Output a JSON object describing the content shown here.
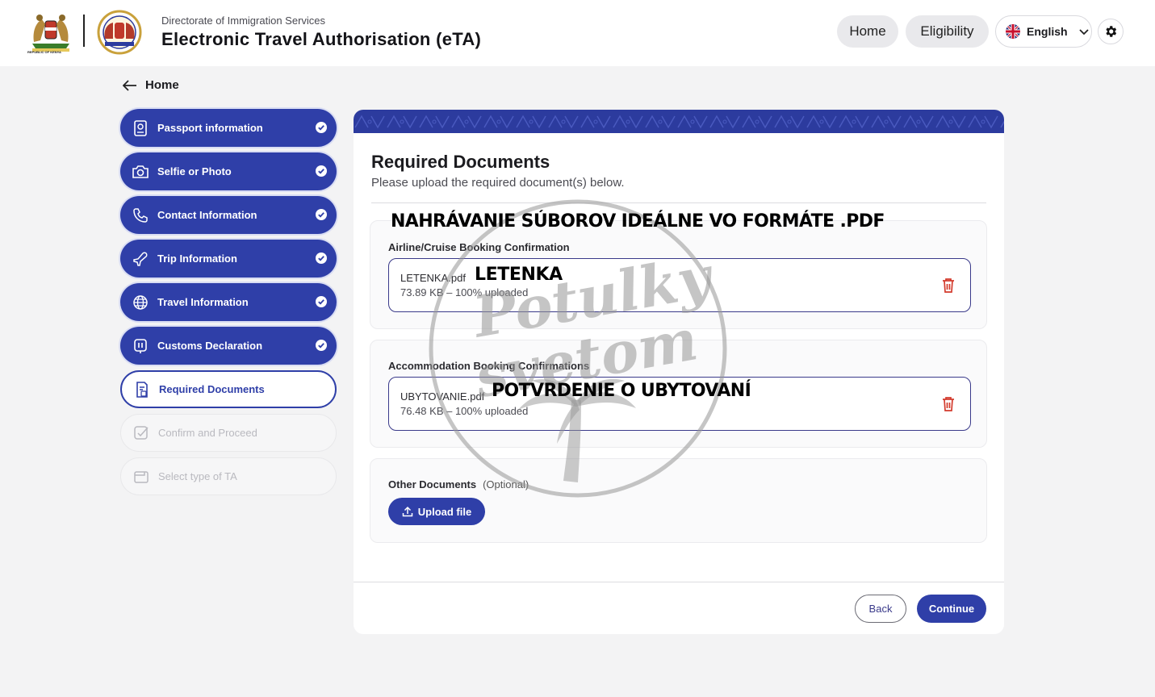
{
  "header": {
    "subtitle": "Directorate of Immigration Services",
    "title": "Electronic Travel Authorisation (eTA)",
    "kenya_logo_caption": "REPUBLIC OF KENYA",
    "nav_home": "Home",
    "nav_eligibility": "Eligibility",
    "language": "English"
  },
  "back_link": "Home",
  "sidebar": {
    "steps": [
      {
        "label": "Passport information",
        "status": "done",
        "icon": "passport-icon"
      },
      {
        "label": "Selfie or Photo",
        "status": "done",
        "icon": "camera-icon"
      },
      {
        "label": "Contact Information",
        "status": "done",
        "icon": "phone-icon"
      },
      {
        "label": "Trip Information",
        "status": "done",
        "icon": "plane-icon"
      },
      {
        "label": "Travel Information",
        "status": "done",
        "icon": "globe-icon"
      },
      {
        "label": "Customs Declaration",
        "status": "done",
        "icon": "customs-icon"
      },
      {
        "label": "Required Documents",
        "status": "active",
        "icon": "document-icon"
      },
      {
        "label": "Confirm and Proceed",
        "status": "todo",
        "icon": "checkbox-icon"
      },
      {
        "label": "Select type of TA",
        "status": "todo",
        "icon": "wallet-icon"
      }
    ]
  },
  "main": {
    "title": "Required Documents",
    "subtitle": "Please upload the required document(s) below.",
    "sections": {
      "airline": {
        "label": "Airline/Cruise Booking Confirmation",
        "file_name": "LETENKA.pdf",
        "file_meta": "73.89 KB – 100% uploaded"
      },
      "accommodation": {
        "label": "Accommodation Booking Confirmations",
        "file_name": "UBYTOVANIE.pdf",
        "file_meta": "76.48 KB – 100% uploaded"
      },
      "other": {
        "label": "Other Documents",
        "optional": "(Optional)",
        "upload_label": "Upload file"
      }
    },
    "back_button": "Back",
    "continue_button": "Continue"
  },
  "overlay": {
    "main_note": "NAHRÁVANIE SÚBOROV IDEÁLNE VO FORMÁTE .PDF",
    "letenka_note": "LETENKA",
    "ubytovanie_note": "POTVRDENIE O UBYTOVANÍ",
    "watermark_line1": "Potulky",
    "watermark_line2": "svetom"
  },
  "colors": {
    "primary": "#2f3fa8",
    "banner": "#2c3b9e",
    "danger": "#d33a2c",
    "background": "#f3f3f4"
  }
}
